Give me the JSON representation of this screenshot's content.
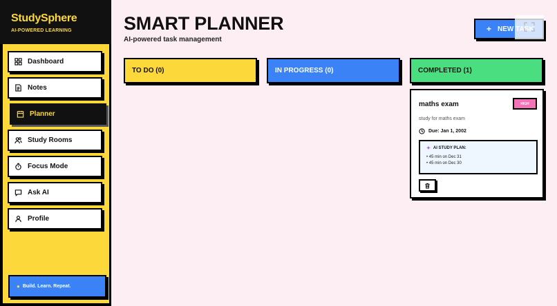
{
  "brand": {
    "name": "StudySphere",
    "tagline": "AI-POWERED LEARNING"
  },
  "sidebar": {
    "items": [
      {
        "label": "Dashboard",
        "icon": "grid-icon",
        "active": false
      },
      {
        "label": "Notes",
        "icon": "file-text-icon",
        "active": false
      },
      {
        "label": "Planner",
        "icon": "calendar-icon",
        "active": true
      },
      {
        "label": "Study Rooms",
        "icon": "users-icon",
        "active": false
      },
      {
        "label": "Focus Mode",
        "icon": "timer-icon",
        "active": false
      },
      {
        "label": "Ask AI",
        "icon": "chat-icon",
        "active": false
      },
      {
        "label": "Profile",
        "icon": "user-icon",
        "active": false
      }
    ],
    "footer": {
      "label": "Build. Learn. Repeat.",
      "icon": "pin-icon"
    }
  },
  "header": {
    "title": "SMART PLANNER",
    "subtitle": "AI-powered task management",
    "new_task_label": "NEW TASK",
    "new_task_icon": "plus-icon"
  },
  "columns": [
    {
      "label": "TO DO (0)",
      "color": "#fcd83a"
    },
    {
      "label": "IN PROGRESS (0)",
      "color": "#3b82f6"
    },
    {
      "label": "COMPLETED (1)",
      "color": "#4ade80"
    }
  ],
  "task": {
    "title": "maths exam",
    "priority": "HIGH",
    "description": "study for maths exam",
    "due": "Due: Jan 1, 2002",
    "plan_title": "AI STUDY PLAN:",
    "plan_items": [
      "• 45 min on Dec 31",
      "• 45 min on Dec 30"
    ]
  },
  "colors": {
    "accent_yellow": "#fcd83a",
    "accent_blue": "#3b82f6",
    "accent_green": "#4ade80",
    "badge_pink": "#f472b6",
    "background": "#fdeef3"
  }
}
